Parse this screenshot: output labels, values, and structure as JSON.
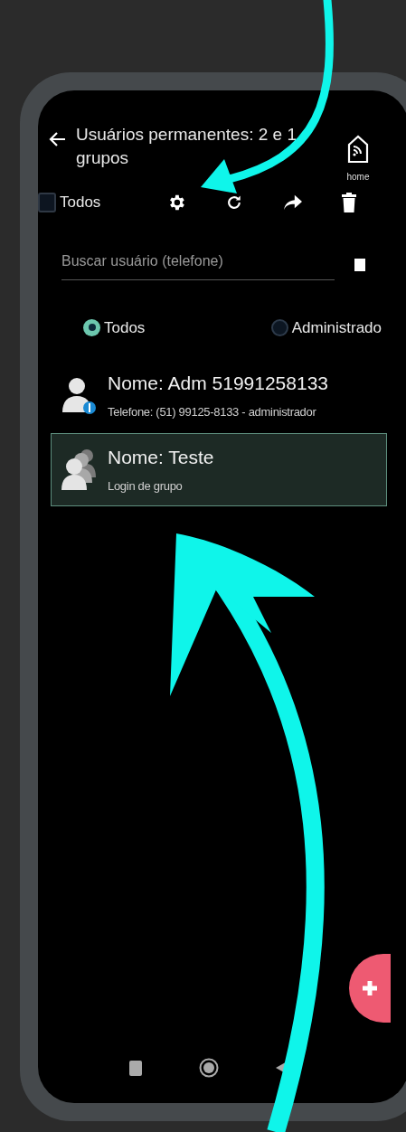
{
  "app_bar": {
    "title": "Usuários permanentes: 2 e 1 grupos",
    "home_label": "home"
  },
  "toolbar": {
    "select_all": {
      "label": "Todos",
      "checked": false
    }
  },
  "search": {
    "placeholder": "Buscar usuário (telefone)"
  },
  "filters": [
    {
      "label": "Todos",
      "selected": true
    },
    {
      "label": "Administrado",
      "selected": false
    }
  ],
  "users": [
    {
      "kind": "admin",
      "name": "Nome: Adm 51991258133",
      "detail": "Telefone: (51) 99125-8133 - administrador",
      "selected": false
    },
    {
      "kind": "group",
      "name": "Nome: Teste",
      "detail": "Login de grupo",
      "selected": true
    }
  ]
}
